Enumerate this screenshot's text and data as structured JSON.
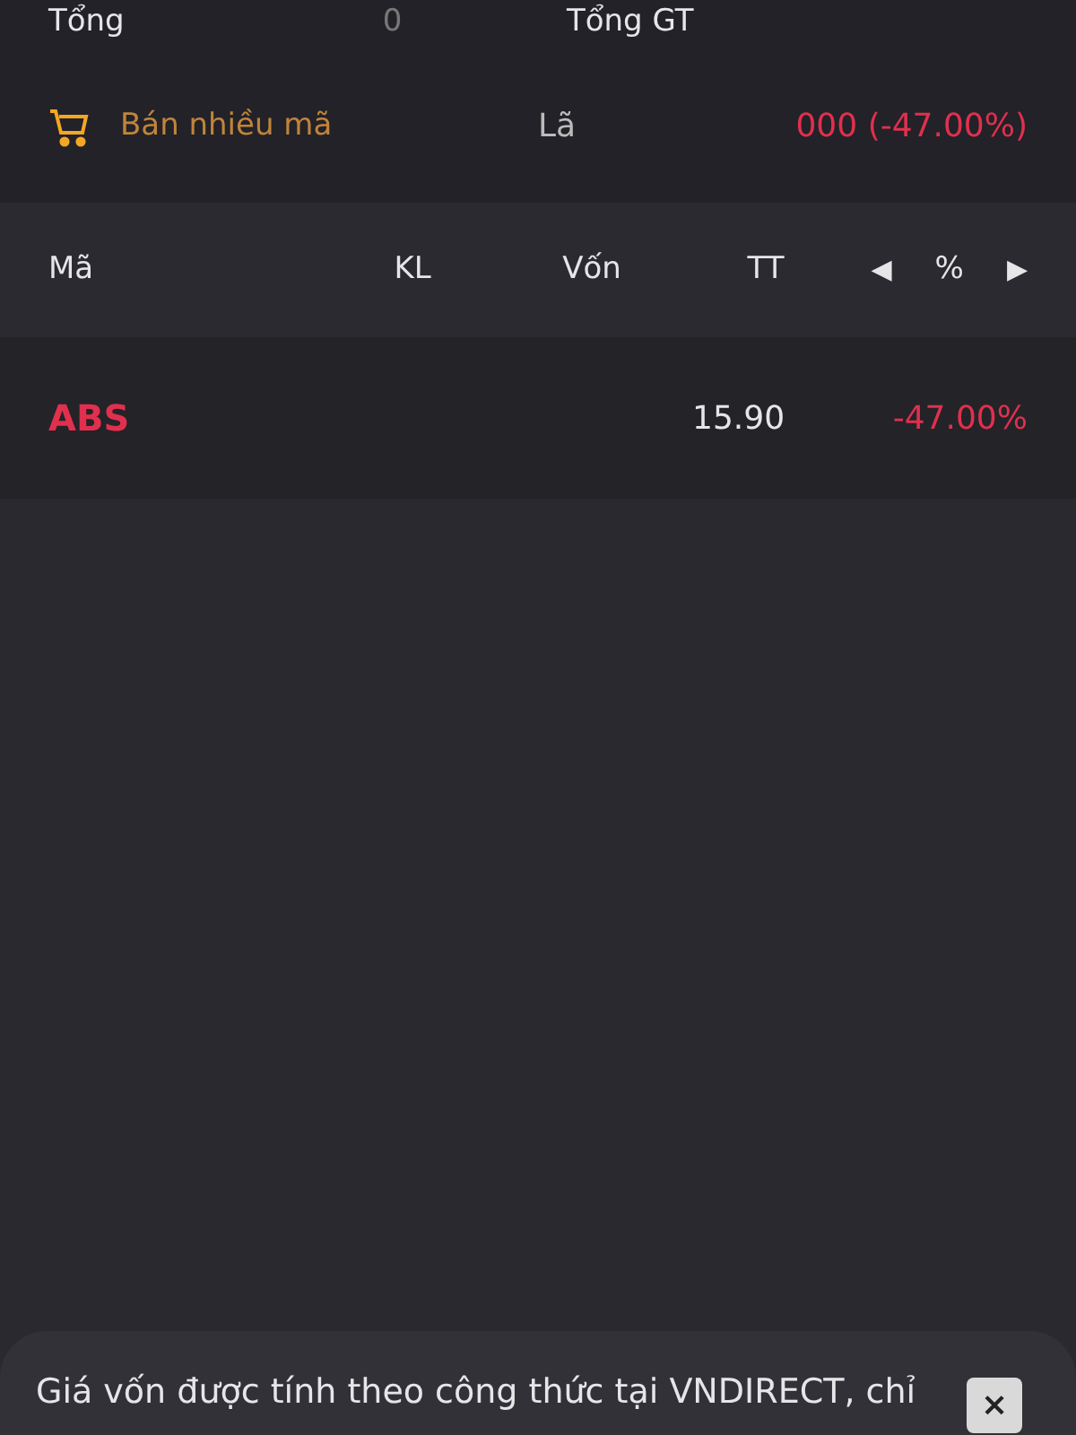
{
  "summary": {
    "total_label": "Tổng",
    "total_value": "0",
    "total_value_label": "Tổng GT",
    "sell_many": "Bán nhiều mã",
    "pnl_label": "Lã",
    "pnl_value": "000 (-47.00%)"
  },
  "table": {
    "columns": [
      {
        "label": "Mã"
      },
      {
        "label": "KL"
      },
      {
        "label": "Vốn"
      },
      {
        "label": "TT"
      },
      {
        "label": "%"
      }
    ],
    "prev": "◀",
    "next": "▶",
    "rows": [
      {
        "symbol": "ABS",
        "price": "15.90",
        "change": "-47.00%"
      }
    ]
  },
  "notice": {
    "text": "Giá vốn được tính theo công thức tại VNDIRECT, chỉ",
    "close": "×"
  }
}
